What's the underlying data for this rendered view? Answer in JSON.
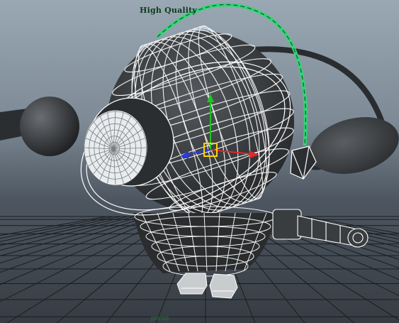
{
  "viewport": {
    "quality_label": "High Quality",
    "camera_label": "persp",
    "colors": {
      "wireframe": "#ffffff",
      "selected": "#35d477",
      "axis_x": "#e02a2a",
      "axis_y": "#21c421",
      "axis_z": "#2a3be0",
      "manipulator": "#ffd400",
      "grid": "#1a1d20"
    },
    "icons": [
      "move-manipulator-icon",
      "grid-floor"
    ]
  }
}
